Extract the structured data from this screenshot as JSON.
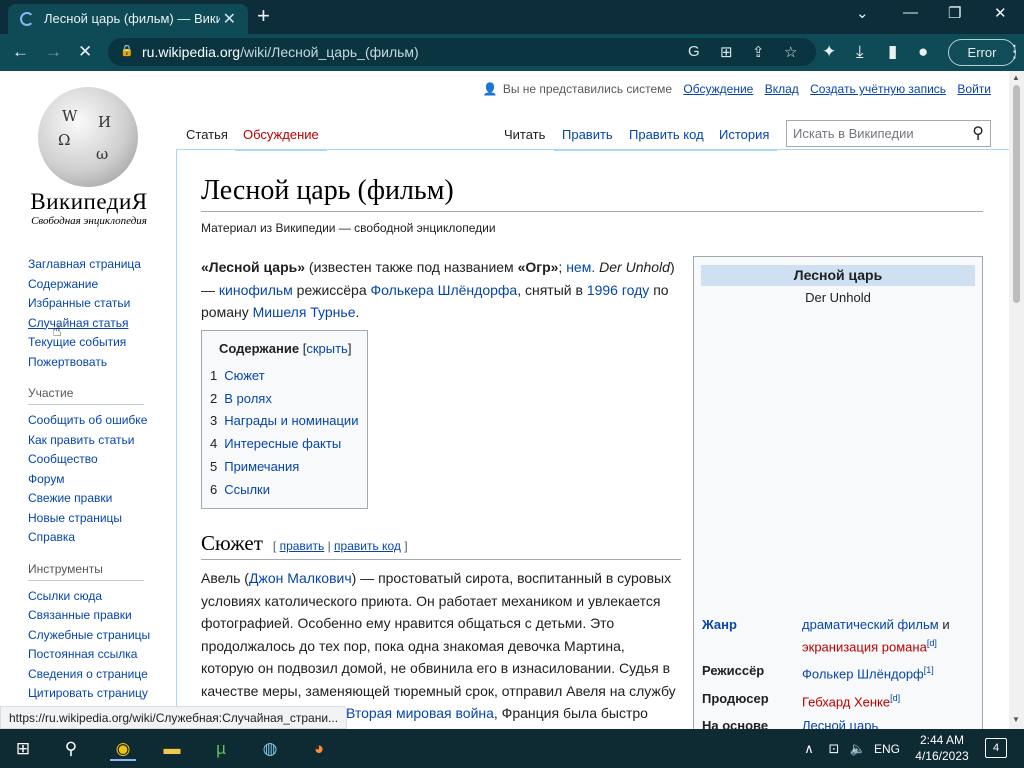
{
  "browser": {
    "tab_title": "Лесной царь (фильм) — Википе",
    "url_host": "ru.wikipedia.org",
    "url_path": "/wiki/Лесной_царь_(фильм)",
    "error_label": "Error"
  },
  "wiki": {
    "logo_name": "ВикипедиЯ",
    "logo_sub": "Свободная энциклопедия",
    "personal": {
      "anon": "Вы не представились системе",
      "talk": "Обсуждение",
      "contrib": "Вклад",
      "create": "Создать учётную запись",
      "login": "Войти"
    },
    "tabs": {
      "article": "Статья",
      "discussion": "Обсуждение",
      "read": "Читать",
      "edit": "Править",
      "edit_code": "Править код",
      "history": "История"
    },
    "search_placeholder": "Искать в Википедии",
    "nav": [
      "Заглавная страница",
      "Содержание",
      "Избранные статьи",
      "Случайная статья",
      "Текущие события",
      "Пожертвовать"
    ],
    "participation_title": "Участие",
    "participation": [
      "Сообщить об ошибке",
      "Как править статьи",
      "Сообщество",
      "Форум",
      "Свежие правки",
      "Новые страницы",
      "Справка"
    ],
    "tools_title": "Инструменты",
    "tools": [
      "Ссылки сюда",
      "Связанные правки",
      "Служебные страницы",
      "Постоянная ссылка",
      "Сведения о странице",
      "Цитировать страницу"
    ]
  },
  "article": {
    "title": "Лесной царь (фильм)",
    "tagline": "Материал из Википедии — свободной энциклопедии",
    "lead": {
      "bold1": "«Лесной царь»",
      "t1": " (известен также под названием ",
      "bold2": "«Огр»",
      "t2": "; ",
      "lang": "нем.",
      "orig": " Der Unhold",
      "t3": ") — ",
      "l_film": "кинофильм",
      "t4": " режиссёра ",
      "l_dir": "Фолькера Шлёндорфа",
      "t5": ", снятый в ",
      "l_year": "1996 году",
      "t6": " по роману ",
      "l_author": "Мишеля Турнье",
      "t7": "."
    },
    "toc": {
      "title": "Содержание",
      "hide": "скрыть",
      "items": [
        {
          "n": "1",
          "label": "Сюжет"
        },
        {
          "n": "2",
          "label": "В ролях"
        },
        {
          "n": "3",
          "label": "Награды и номинации"
        },
        {
          "n": "4",
          "label": "Интересные факты"
        },
        {
          "n": "5",
          "label": "Примечания"
        },
        {
          "n": "6",
          "label": "Ссылки"
        }
      ]
    },
    "section1": {
      "title": "Сюжет",
      "edit": "править",
      "edit_code": "править код"
    },
    "plot": {
      "t1": "Авель (",
      "l_actor": "Джон Малкович",
      "t2": ") — простоватый сирота, воспитанный в суровых условиях католического приюта. Он работает механиком и увлекается фотографией. Особенно ему нравится общаться с детьми. Это продолжалось до тех пор, пока одна знакомая девочка Мартина, которую он подвозил домой, не обвинила его в изнасиловании. Судья в качестве меры, заменяющей тюремный срок, отправил Авеля на службу в армию. Начиналась ",
      "l_war": "Вторая мировая война",
      "t3": ", Франция была быстро"
    },
    "infobox": {
      "title": "Лесной царь",
      "original": "Der Unhold",
      "rows": [
        {
          "key": "Жанр",
          "v1": "драматический фильм",
          "v1_note": " и ",
          "v2": "экранизация романа",
          "sup": "[d]"
        },
        {
          "key": "Режиссёр",
          "v1": "Фолькер Шлёндорф",
          "sup": "[1]"
        },
        {
          "key": "Продюсер",
          "v1": "Гебхард Хенке",
          "sup": "[d]"
        },
        {
          "key": "На основе",
          "v1": "Лесной царь"
        }
      ]
    }
  },
  "status_url": "https://ru.wikipedia.org/wiki/Служебная:Случайная_страни...",
  "taskbar": {
    "lang": "ENG",
    "time": "2:44 AM",
    "date": "4/16/2023",
    "notifications": "4"
  }
}
